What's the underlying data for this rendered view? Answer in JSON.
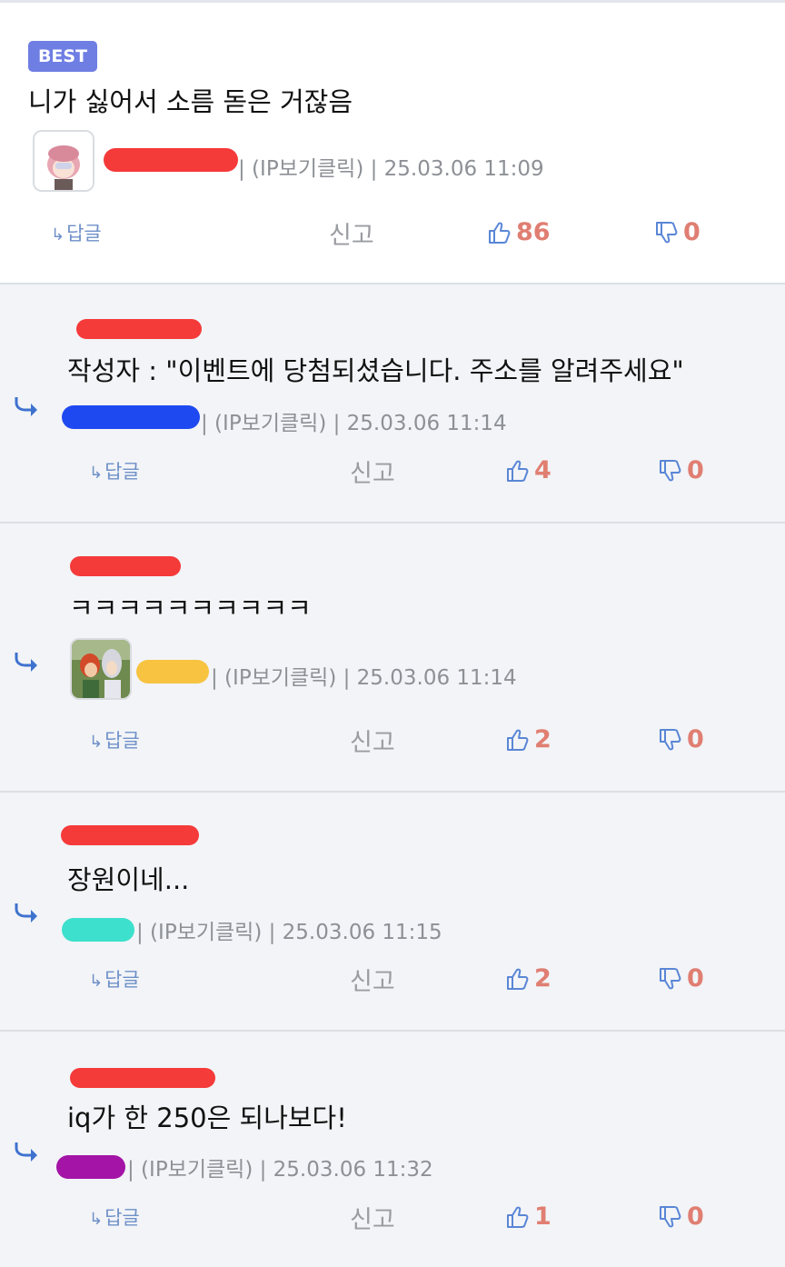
{
  "comments": [
    {
      "best_label": "BEST",
      "text": "니가 싫어서 소름 돋은 거잖음",
      "meta": "| (IP보기클릭) | 25.03.06 11:09",
      "actions": {
        "reply": "답글",
        "report": "신고",
        "likes": "86",
        "dislikes": "0"
      }
    },
    {
      "text": "작성자 : \"이벤트에 당첨되셨습니다. 주소를 알려주세요\"",
      "meta": "| (IP보기클릭) | 25.03.06 11:14",
      "actions": {
        "reply": "답글",
        "report": "신고",
        "likes": "4",
        "dislikes": "0"
      }
    },
    {
      "text": "ㅋㅋㅋㅋㅋㅋㅋㅋㅋㅋ",
      "meta": "| (IP보기클릭) | 25.03.06 11:14",
      "actions": {
        "reply": "답글",
        "report": "신고",
        "likes": "2",
        "dislikes": "0"
      }
    },
    {
      "text": "장원이네...",
      "meta": "| (IP보기클릭) | 25.03.06 11:15",
      "actions": {
        "reply": "답글",
        "report": "신고",
        "likes": "2",
        "dislikes": "0"
      }
    },
    {
      "text": "iq가 한 250은 되나보다!",
      "meta": "| (IP보기클릭) | 25.03.06 11:32",
      "actions": {
        "reply": "답글",
        "report": "신고",
        "likes": "1",
        "dislikes": "0"
      }
    }
  ],
  "colors": {
    "badge": "#6f7ee3",
    "like_count": "#e07e72",
    "icon_blue": "#5a86d6",
    "mask_red": "#f53a3a",
    "mask_blue": "#1f49f0",
    "mask_yellow": "#f7c340",
    "mask_cyan": "#3de0cc",
    "mask_purple": "#a414a6"
  },
  "icons": [
    "reply-arrow-icon",
    "thumbs-up-icon",
    "thumbs-down-icon",
    "avatar-image"
  ]
}
